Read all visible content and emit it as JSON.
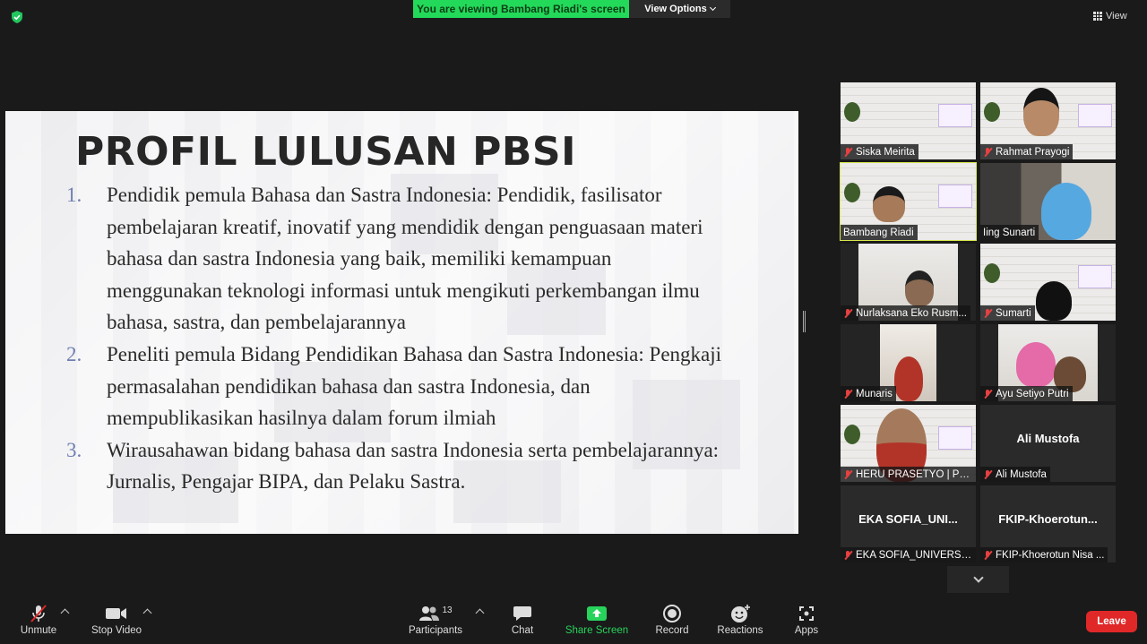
{
  "top_bar": {
    "banner": "You are viewing Bambang Riadi's screen",
    "view_options": "View Options",
    "view": "View"
  },
  "slide": {
    "title": "PROFIL LULUSAN PBSI",
    "items": [
      {
        "num": "1.",
        "lines": [
          "Pendidik pemula Bahasa dan Sastra Indonesia: Pendidik, fasilisator",
          "pembelajaran kreatif, inovatif yang mendidik dengan penguasaan materi",
          "bahasa dan sastra Indonesia yang baik, memiliki kemampuan",
          "menggunakan teknologi informasi untuk mengikuti perkembangan ilmu",
          "bahasa, sastra, dan pembelajarannya"
        ]
      },
      {
        "num": "2.",
        "lines": [
          "Peneliti pemula Bidang Pendidikan Bahasa dan Sastra Indonesia: Pengkaji",
          "permasalahan pendidikan bahasa dan sastra Indonesia, dan",
          "mempublikasikan hasilnya dalam forum ilmiah"
        ]
      },
      {
        "num": "3.",
        "lines": [
          "Wirausahawan bidang bahasa dan sastra Indonesia serta pembelajarannya:",
          "Jurnalis, Pengajar BIPA, dan Pelaku Sastra."
        ]
      }
    ]
  },
  "participants": [
    {
      "name": "Siska Meirita"
    },
    {
      "name": "Rahmat Prayogi"
    },
    {
      "name": "Bambang Riadi"
    },
    {
      "name": "Iing Sunarti"
    },
    {
      "name": "Nurlaksana Eko Rusm..."
    },
    {
      "name": "Sumarti"
    },
    {
      "name": "Munaris"
    },
    {
      "name": "Ayu Setiyo Putri"
    },
    {
      "name": "HERU PRASETYO | PE..."
    },
    {
      "name": "Ali Mustofa",
      "big": "Ali Mustofa"
    },
    {
      "name": "EKA SOFIA_UNIVERSI...",
      "big": "EKA SOFIA_UNI..."
    },
    {
      "name": "FKIP-Khoerotun Nisa ...",
      "big": "FKIP-Khoerotun..."
    }
  ],
  "toolbar": {
    "unmute": "Unmute",
    "stop_video": "Stop Video",
    "participants": "Participants",
    "participants_count": "13",
    "chat": "Chat",
    "share_screen": "Share Screen",
    "record": "Record",
    "reactions": "Reactions",
    "apps": "Apps",
    "leave": "Leave"
  },
  "colors": {
    "banner_green": "#23d959",
    "share_green": "#27d35b",
    "leave_red": "#e02828",
    "active_speaker": "#d7e64a"
  }
}
